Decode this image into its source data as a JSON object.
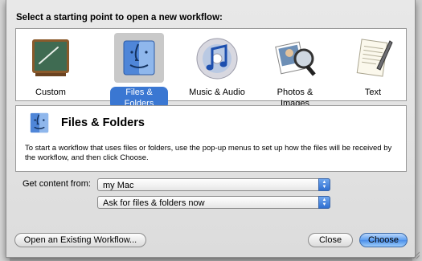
{
  "dialog": {
    "heading": "Select a starting point to open a new workflow:",
    "choices": [
      {
        "label": "Custom",
        "icon": "chalkboard-icon",
        "selected": false
      },
      {
        "label": "Files & Folders",
        "icon": "finder-icon",
        "selected": true
      },
      {
        "label": "Music & Audio",
        "icon": "itunes-cd-icon",
        "selected": false
      },
      {
        "label": "Photos & Images",
        "icon": "photos-magnifier-icon",
        "selected": false
      },
      {
        "label": "Text",
        "icon": "text-document-icon",
        "selected": false
      }
    ],
    "detail": {
      "title": "Files & Folders",
      "description": "To start a workflow that uses files or folders, use the pop-up menus to set up how the files will be received by the workflow, and then click Choose."
    },
    "get_content_label": "Get content from:",
    "source_popup": "my Mac",
    "files_popup": "Ask for files & folders now",
    "buttons": {
      "open_existing": "Open an Existing Workflow...",
      "close": "Close",
      "choose": "Choose"
    },
    "colors": {
      "selection": "#3a77d2",
      "default_button": "#5d9ef0"
    }
  }
}
